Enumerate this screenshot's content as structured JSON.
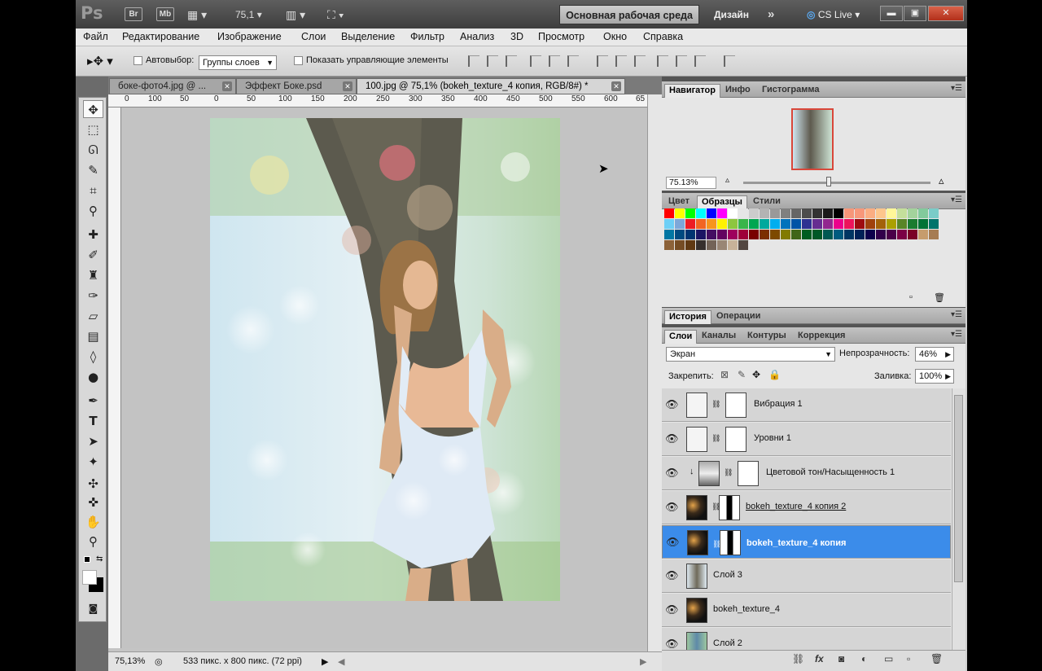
{
  "appbar": {
    "logo": "Ps",
    "br": "Br",
    "mb": "Mb",
    "zoom": "75,1",
    "workspace": "Основная рабочая среда",
    "design": "Дизайн",
    "more": "»",
    "cslive": "CS Live"
  },
  "menu": [
    "Файл",
    "Редактирование",
    "Изображение",
    "Слои",
    "Выделение",
    "Фильтр",
    "Анализ",
    "3D",
    "Просмотр",
    "Окно",
    "Справка"
  ],
  "options": {
    "autoselect": "Автовыбор:",
    "autoselect_value": "Группы слоев",
    "show_controls": "Показать управляющие элементы"
  },
  "tabs": [
    {
      "label": "боке-фото4.jpg @ ..."
    },
    {
      "label": "Эффект Боке.psd"
    },
    {
      "label": "100.jpg @ 75,1% (bokeh_texture_4 копия, RGB/8#) *"
    }
  ],
  "ruler": [
    "0",
    "100",
    "50",
    "0",
    "50",
    "100",
    "150",
    "200",
    "250",
    "300",
    "350",
    "400",
    "450",
    "500",
    "550",
    "600",
    "65"
  ],
  "status": {
    "zoom": "75,13%",
    "size": "533 пикс. x 800 пикс. (72 ppi)"
  },
  "navigator": {
    "tabs": [
      "Навигатор",
      "Инфо",
      "Гистограмма"
    ],
    "zoom": "75.13%"
  },
  "swatch_panel": {
    "tabs": [
      "Цвет",
      "Образцы",
      "Стили"
    ]
  },
  "history_panel": {
    "tabs": [
      "История",
      "Операции"
    ]
  },
  "layers_panel": {
    "tabs": [
      "Слои",
      "Каналы",
      "Контуры",
      "Коррекция"
    ],
    "blend_mode": "Экран",
    "opacity_label": "Непрозрачность:",
    "opacity": "46%",
    "lock_label": "Закрепить:",
    "fill_label": "Заливка:",
    "fill": "100%"
  },
  "layers": [
    {
      "name": "Вибрация 1"
    },
    {
      "name": "Уровни 1"
    },
    {
      "name": "Цветовой тон/Насыщенность 1"
    },
    {
      "name": "bokeh_texture_4 копия 2"
    },
    {
      "name": "bokeh_texture_4 копия"
    },
    {
      "name": "Слой 3"
    },
    {
      "name": "bokeh_texture_4"
    },
    {
      "name": "Слой 2"
    }
  ],
  "colors": {
    "selected_layer": "#3b8cea",
    "workspace_button": "#bcbcbc"
  }
}
